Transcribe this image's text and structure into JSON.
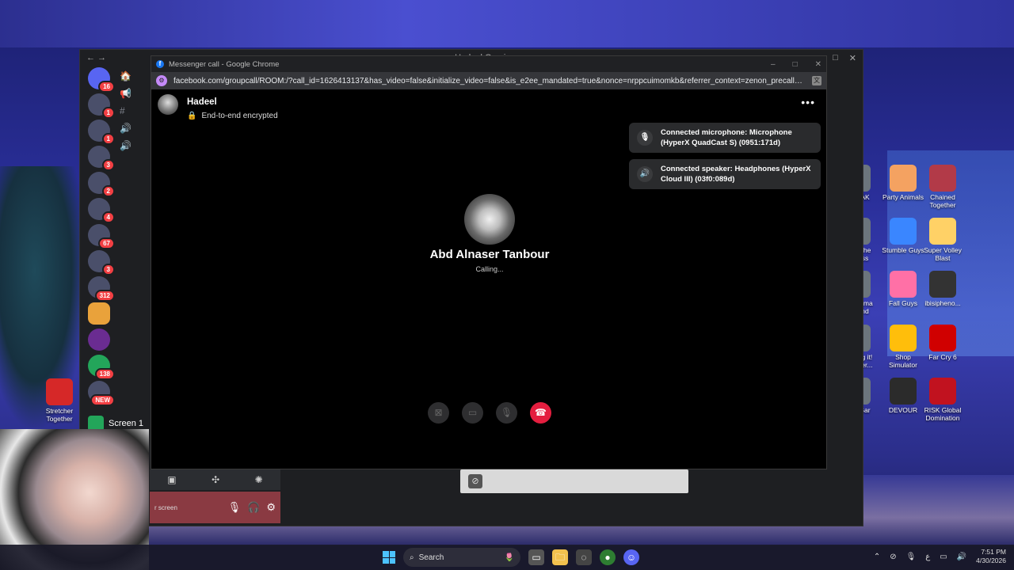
{
  "chrome": {
    "window_title": "Messenger call - Google Chrome",
    "url": "facebook.com/groupcall/ROOM:/?call_id=1626413137&has_video=false&initialize_video=false&is_e2ee_mandated=true&nonce=nrppcuimomkb&referrer_context=zenon_precall&thread_type...",
    "controls": {
      "minimize": "–",
      "maximize": "□",
      "close": "✕"
    }
  },
  "call": {
    "caller_name": "Hadeel",
    "encryption_text": "End-to-end encrypted",
    "more_label": "•••",
    "callee_name": "Abd Alnaser Tanbour",
    "status": "Calling...",
    "toasts": [
      {
        "icon": "microphone-icon",
        "text": "Connected microphone: Microphone (HyperX QuadCast S) (0951:171d)"
      },
      {
        "icon": "speaker-icon",
        "text": "Connected speaker: Headphones (HyperX Cloud III) (03f0:089d)"
      }
    ],
    "buttons": {
      "effects": "⊠",
      "video": "▭",
      "mute": "🎙",
      "end": "☎"
    }
  },
  "discord": {
    "title": "Hadeel Gaming",
    "server_badges": [
      "16",
      "1",
      "1",
      "3",
      "2",
      "4",
      "67",
      "3",
      "312",
      "",
      "",
      "138",
      "NEW"
    ],
    "screen_label": "Screen 1",
    "panel_label": "r screen",
    "panel_icons": {
      "mic": "🎙",
      "headphones": "🎧",
      "settings": "⚙"
    }
  },
  "desktop_icons": [
    {
      "label": "Stretcher Together",
      "color": "#d62828"
    },
    {
      "label": "Party Animals",
      "color": "#f4a261"
    },
    {
      "label": "Chained Together",
      "color": "#b23a48"
    },
    {
      "label": "Stumble Guys",
      "color": "#3a86ff"
    },
    {
      "label": "Super Volley Blast",
      "color": "#ffd166"
    },
    {
      "label": "Fall Guys",
      "color": "#ff70a6"
    },
    {
      "label": "ibisipheno...",
      "color": "#333333"
    },
    {
      "label": "Shop Simulator",
      "color": "#ffbe0b"
    },
    {
      "label": "Far Cry 6",
      "color": "#d00000"
    },
    {
      "label": "DEVOUR",
      "color": "#2b2b2b"
    },
    {
      "label": "RISK Global Domination",
      "color": "#c1121f"
    },
    {
      "label": "AK",
      "color": "#6c757d"
    },
    {
      "label": "The ss",
      "color": "#6c757d"
    },
    {
      "label": "arma nd",
      "color": "#6c757d"
    },
    {
      "label": "ng it! her...",
      "color": "#6c757d"
    },
    {
      "label": "Bar",
      "color": "#6c757d"
    }
  ],
  "taskbar": {
    "search_placeholder": "Search",
    "time": "7:51 PM",
    "date": "4/30/2026",
    "lang": "ع"
  }
}
